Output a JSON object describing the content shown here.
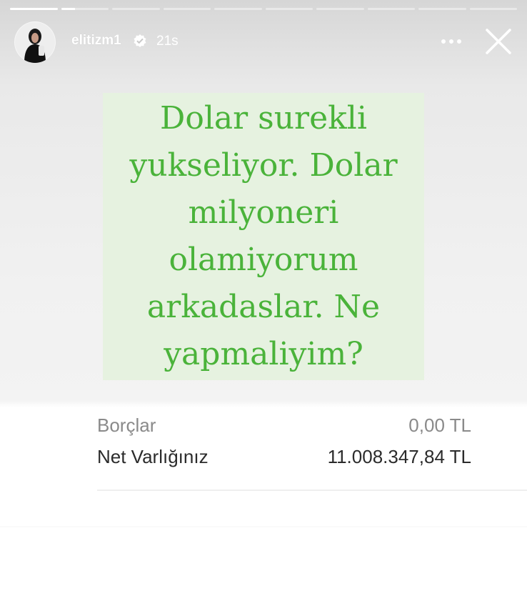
{
  "story": {
    "segment_count": 10,
    "active_segment_progress": 0.3,
    "completed_segments": 1
  },
  "header": {
    "username": "elitizm1",
    "timestamp": "21s"
  },
  "post": {
    "green_text": "Dolar surekli yukseliyor. Dolar milyoneri olamiyorum arkadaslar. Ne yapmaliyim?"
  },
  "account": {
    "rows": [
      {
        "label": "Borçlar",
        "value": "0,00 TL"
      },
      {
        "label": "Net Varlığınız",
        "value": "11.008.347,84 TL"
      }
    ]
  },
  "colors": {
    "text_green": "#4ab33a",
    "box_green": "#e6f2e0"
  },
  "icons": [
    "verified-badge-icon",
    "more-options-icon",
    "close-icon"
  ]
}
